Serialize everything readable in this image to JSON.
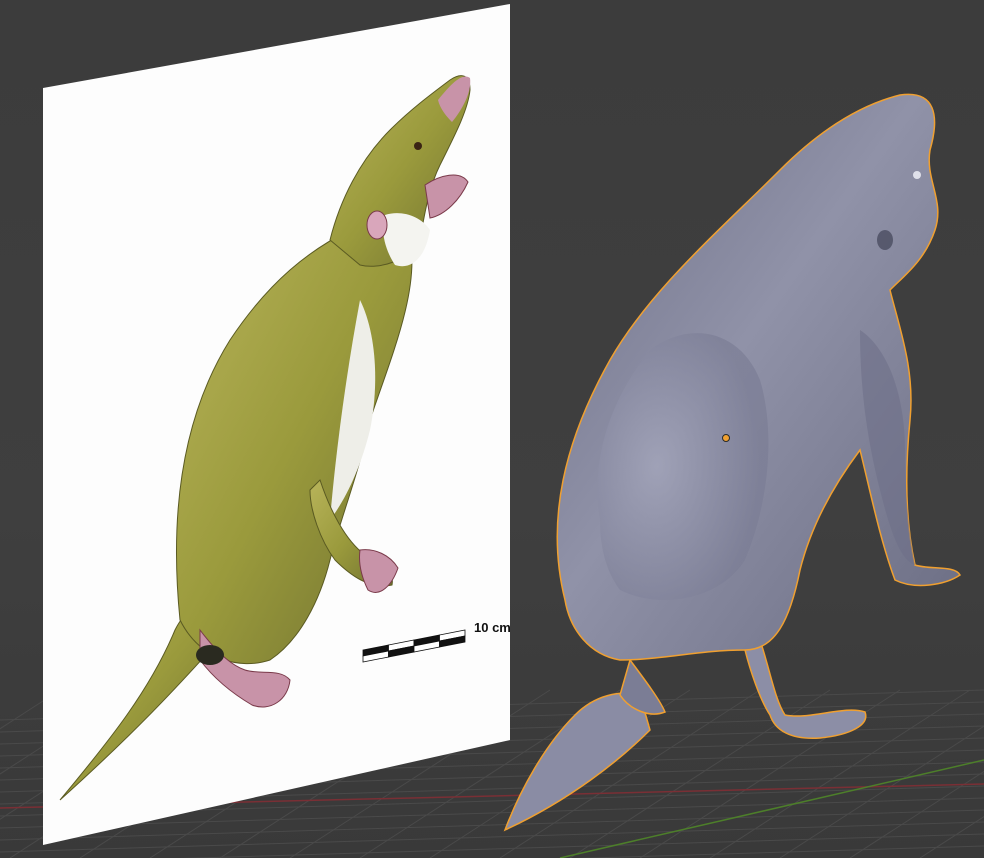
{
  "viewport": {
    "background_color": "#3d3d3d",
    "grid_color": "#4a4a4a",
    "x_axis_color": "#7a2f35",
    "y_axis_color": "#4d7f2a"
  },
  "reference_image": {
    "scale_bar_label": "10 cm",
    "paper_color": "#fdfdfd",
    "fur_color": "#9a9a3c",
    "skin_color": "#c893a8"
  },
  "model": {
    "surface_color": "#8c8ea6",
    "selection_outline_color": "#f0a030",
    "origin_point_color": "#f0a030"
  }
}
